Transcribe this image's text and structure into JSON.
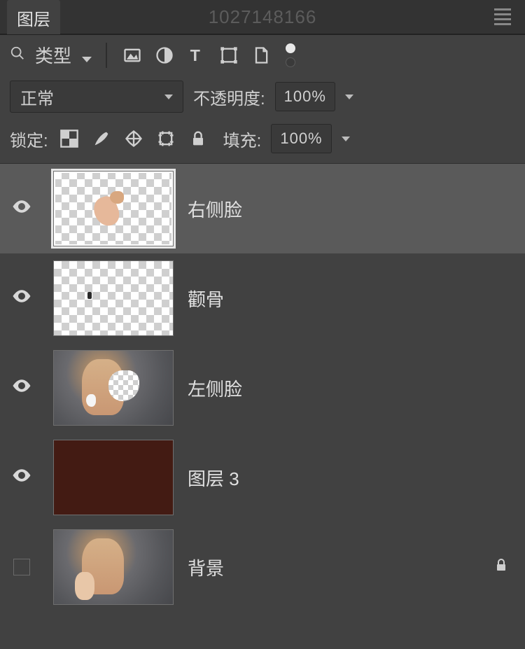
{
  "panel": {
    "tab_label": "图层"
  },
  "watermark": "1027148166",
  "filter": {
    "type_label": "类型"
  },
  "blend": {
    "mode_label": "正常",
    "opacity_label": "不透明度:",
    "opacity_value": "100%"
  },
  "lock": {
    "label": "锁定:",
    "fill_label": "填充:",
    "fill_value": "100%"
  },
  "layers": [
    {
      "name": "右侧脸",
      "visible": true,
      "selected": true,
      "locked": false,
      "thumb": "checker-face-right"
    },
    {
      "name": "颧骨",
      "visible": true,
      "selected": false,
      "locked": false,
      "thumb": "checker-dot"
    },
    {
      "name": "左侧脸",
      "visible": true,
      "selected": false,
      "locked": false,
      "thumb": "photo-checker"
    },
    {
      "name": "图层 3",
      "visible": true,
      "selected": false,
      "locked": false,
      "thumb": "solid-dark"
    },
    {
      "name": "背景",
      "visible": false,
      "selected": false,
      "locked": true,
      "thumb": "photo"
    }
  ]
}
